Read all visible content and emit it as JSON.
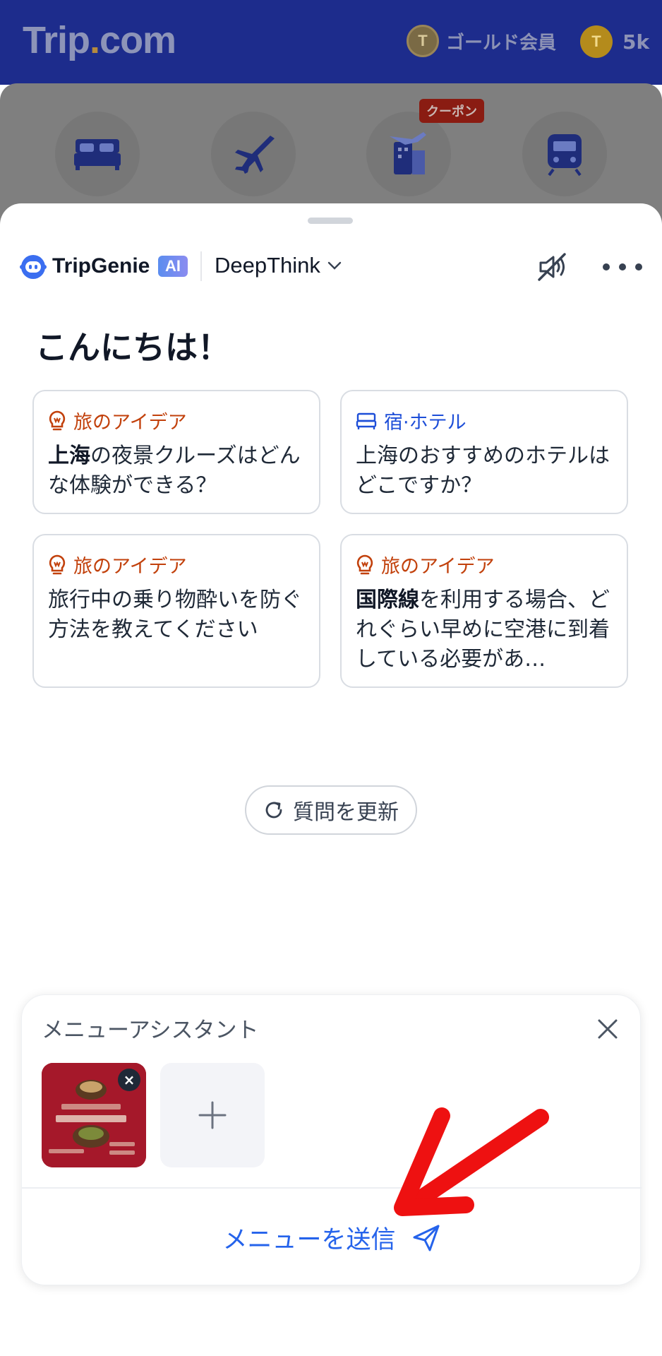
{
  "app": {
    "logo_prefix": "Trip",
    "logo_dot": ".",
    "logo_suffix": "com",
    "member_coin": "T",
    "member_label": "ゴールド会員",
    "points_coin": "T",
    "points_value": "5k"
  },
  "categories": [
    {
      "icon": "bed-icon",
      "label": ""
    },
    {
      "icon": "airplane-icon",
      "label": ""
    },
    {
      "icon": "hotel-flight-icon",
      "label": ""
    },
    {
      "icon": "train-icon",
      "label": ""
    }
  ],
  "coupon_badge": "クーポン",
  "genie": {
    "brand": "TripGenie",
    "ai_badge": "AI",
    "mode": "DeepThink",
    "greeting": "こんにちは！",
    "cards": [
      {
        "tag": "旅のアイデア",
        "tag_type": "idea",
        "bold": "上海",
        "text": "の夜景クルーズはどんな体験ができる？"
      },
      {
        "tag": "宿·ホテル",
        "tag_type": "hotel",
        "bold": "",
        "text": "上海のおすすめのホテルはどこですか？"
      },
      {
        "tag": "旅のアイデア",
        "tag_type": "idea",
        "bold": "",
        "text": "旅行中の乗り物酔いを防ぐ方法を教えてください"
      },
      {
        "tag": "旅のアイデア",
        "tag_type": "idea",
        "bold": "国際線",
        "text": "を利用する場合、どれぐらい早めに空港に到着している必要があ…"
      }
    ],
    "refresh_label": "質問を更新"
  },
  "menu_assistant": {
    "title": "メニューアシスタント",
    "send_label": "メニューを送信"
  },
  "colors": {
    "brand_blue": "#1d2c8c",
    "accent_blue": "#2563eb",
    "idea_orange": "#c2410c",
    "annotation_red": "#ee1111"
  }
}
